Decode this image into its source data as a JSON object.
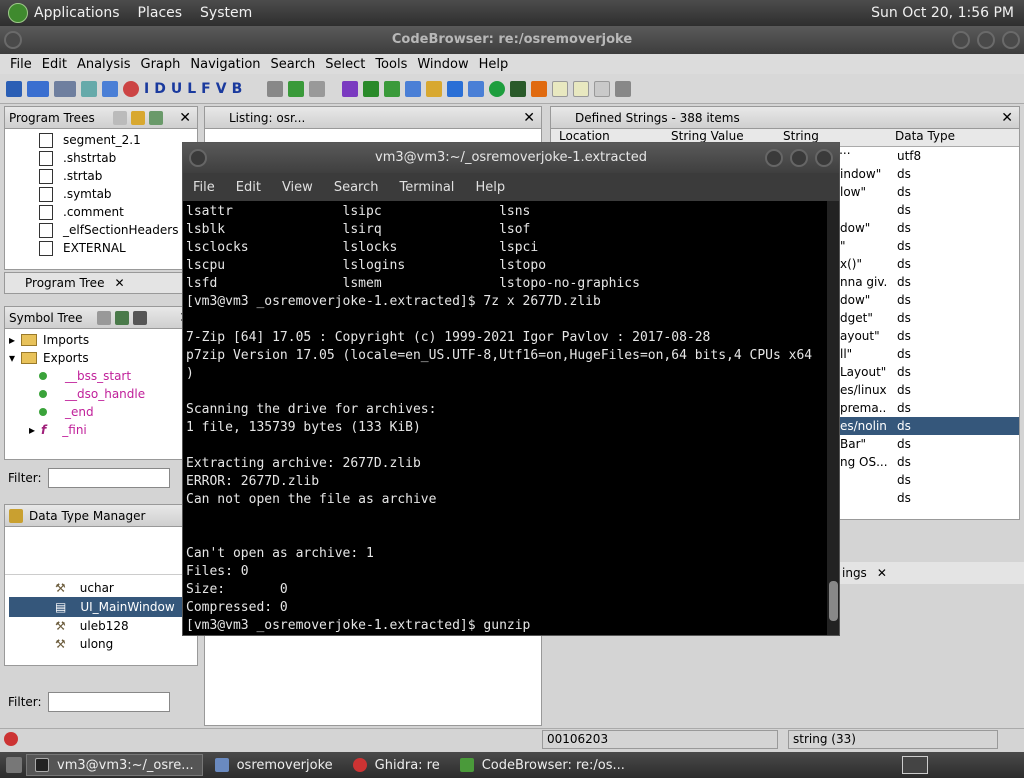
{
  "panel": {
    "apps": "Applications",
    "places": "Places",
    "system": "System",
    "clock": "Sun Oct 20,  1:56 PM"
  },
  "cb": {
    "title": "CodeBrowser: re:/osremoverjoke",
    "menu": [
      "File",
      "Edit",
      "Analysis",
      "Graph",
      "Navigation",
      "Search",
      "Select",
      "Tools",
      "Window",
      "Help"
    ],
    "toolbar_letters": [
      "I",
      "D",
      "U",
      "L",
      "F",
      "V",
      "B"
    ]
  },
  "program_trees": {
    "title": "Program Trees",
    "items": [
      "segment_2.1",
      ".shstrtab",
      ".strtab",
      ".symtab",
      ".comment",
      "_elfSectionHeaders",
      "EXTERNAL"
    ],
    "tab": "Program Tree"
  },
  "symbol_tree": {
    "title": "Symbol Tree",
    "imports": "Imports",
    "exports": "Exports",
    "items": [
      "__bss_start",
      "__dso_handle",
      "_end",
      "_fini"
    ],
    "filter": "Filter:"
  },
  "dtm": {
    "title": "Data Type Manager",
    "items": [
      "uchar",
      "UI_MainWindow",
      "uleb128",
      "ulong"
    ],
    "filter": "Filter:"
  },
  "listing": {
    "title": "Listing:  osr..."
  },
  "strings": {
    "title": "Defined Strings - 388 items",
    "cols": [
      "Location",
      "String Value",
      "String Represen...",
      "Data Type"
    ],
    "rows": [
      {
        "r": "",
        "t": "utf8"
      },
      {
        "r": "indow\"",
        "t": "ds"
      },
      {
        "r": "low\"",
        "t": "ds"
      },
      {
        "r": "",
        "t": "ds"
      },
      {
        "r": "dow\"",
        "t": "ds"
      },
      {
        "r": "\"",
        "t": "ds"
      },
      {
        "r": "x()\"",
        "t": "ds"
      },
      {
        "r": "nna giv...",
        "t": "ds"
      },
      {
        "r": "dow\"",
        "t": "ds"
      },
      {
        "r": "dget\"",
        "t": "ds"
      },
      {
        "r": "ayout\"",
        "t": "ds"
      },
      {
        "r": "ll\"",
        "t": "ds"
      },
      {
        "r": "Layout\"",
        "t": "ds"
      },
      {
        "r": "es/linux...",
        "t": "ds"
      },
      {
        "r": "prema...",
        "t": "ds"
      },
      {
        "r": "es/nolin...",
        "t": "ds"
      },
      {
        "r": "Bar\"",
        "t": "ds"
      },
      {
        "r": "ng OS...",
        "t": "ds"
      },
      {
        "r": "",
        "t": "ds"
      },
      {
        "r": "",
        "t": "ds"
      }
    ],
    "tab": "ings"
  },
  "status": {
    "addr": "00106203",
    "type": "string (33)"
  },
  "terminal": {
    "title": "vm3@vm3:~/_osremoverjoke-1.extracted",
    "menu": [
      "File",
      "Edit",
      "View",
      "Search",
      "Terminal",
      "Help"
    ],
    "lines": [
      "lsattr              lsipc               lsns",
      "lsblk               lsirq               lsof",
      "lsclocks            lslocks             lspci",
      "lscpu               lslogins            lstopo",
      "lsfd                lsmem               lstopo-no-graphics",
      "[vm3@vm3 _osremoverjoke-1.extracted]$ 7z x 2677D.zlib",
      "",
      "7-Zip [64] 17.05 : Copyright (c) 1999-2021 Igor Pavlov : 2017-08-28",
      "p7zip Version 17.05 (locale=en_US.UTF-8,Utf16=on,HugeFiles=on,64 bits,4 CPUs x64",
      ")",
      "",
      "Scanning the drive for archives:",
      "1 file, 135739 bytes (133 KiB)",
      "",
      "Extracting archive: 2677D.zlib",
      "ERROR: 2677D.zlib",
      "Can not open the file as archive",
      "",
      "",
      "Can't open as archive: 1",
      "Files: 0",
      "Size:       0",
      "Compressed: 0",
      "[vm3@vm3 _osremoverjoke-1.extracted]$ gunzip"
    ]
  },
  "taskbar": {
    "items": [
      "vm3@vm3:~/_osre...",
      "osremoverjoke",
      "Ghidra: re",
      "CodeBrowser: re:/os..."
    ]
  }
}
